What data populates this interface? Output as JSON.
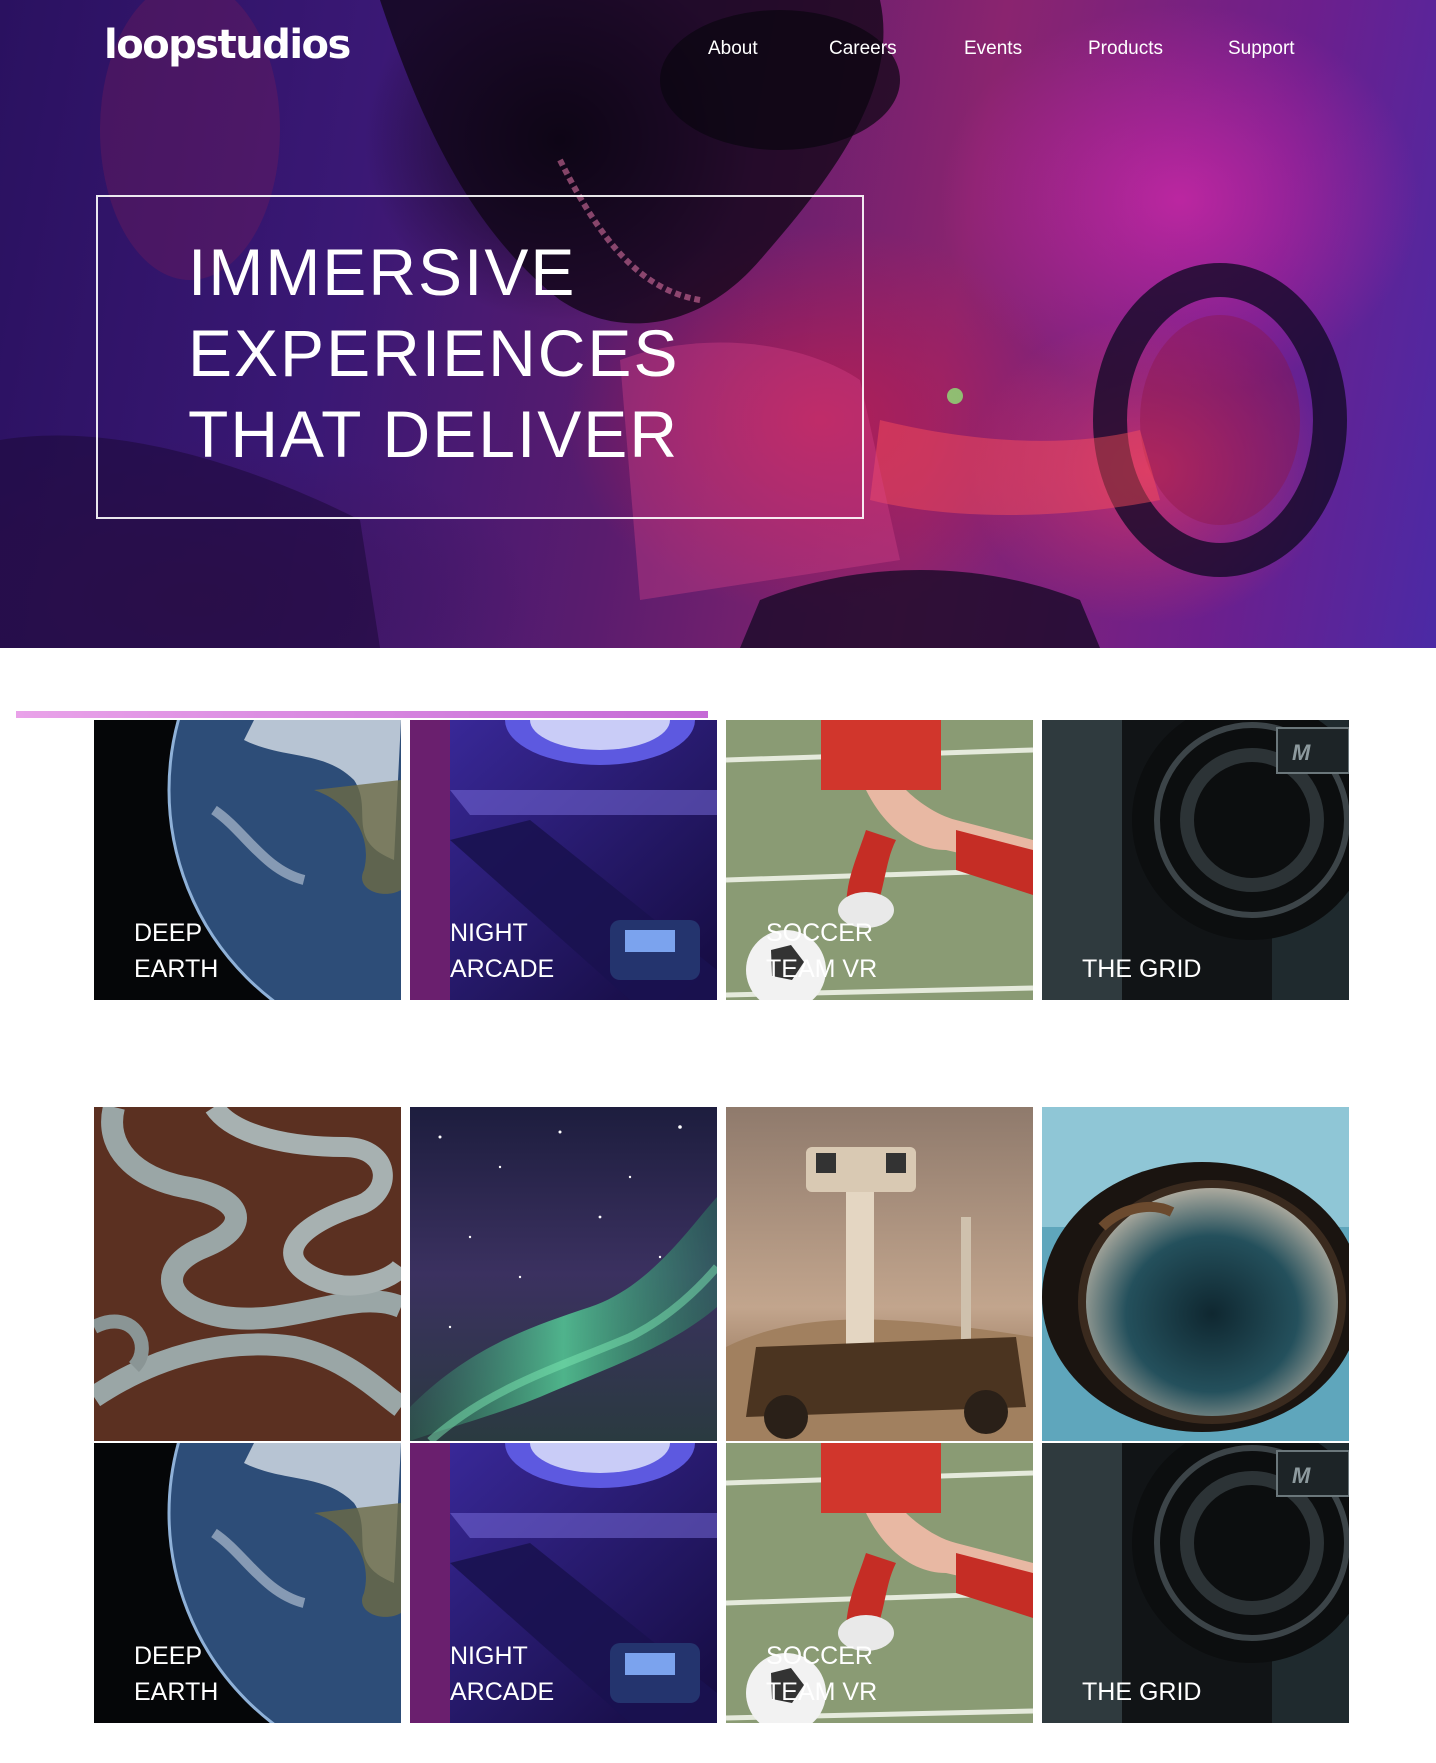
{
  "brand": {
    "logo": "loopstudios"
  },
  "nav": {
    "items": [
      {
        "label": "About"
      },
      {
        "label": "Careers"
      },
      {
        "label": "Events"
      },
      {
        "label": "Products"
      },
      {
        "label": "Support"
      }
    ]
  },
  "hero": {
    "title_lines": [
      "IMMERSIVE",
      "EXPERIENCES",
      "THAT DELIVER"
    ]
  },
  "creations": {
    "row1": [
      {
        "label": "DEEP\nEARTH"
      },
      {
        "label": "NIGHT\nARCADE"
      },
      {
        "label": "SOCCER\nTEAM VR"
      },
      {
        "label": "THE GRID"
      }
    ],
    "row3": [
      {
        "label": "DEEP\nEARTH"
      },
      {
        "label": "NIGHT\nARCADE"
      },
      {
        "label": "SOCCER\nTEAM VR"
      },
      {
        "label": "THE GRID"
      }
    ]
  },
  "colors": {
    "accent": "#d57ee0",
    "label": "#ffffff"
  },
  "icons": [
    "earth-image",
    "arcade-image",
    "soccer-image",
    "car-wheel-image",
    "curvy-road-image",
    "aurora-image",
    "mars-rover-image",
    "tiny-planet-image"
  ]
}
